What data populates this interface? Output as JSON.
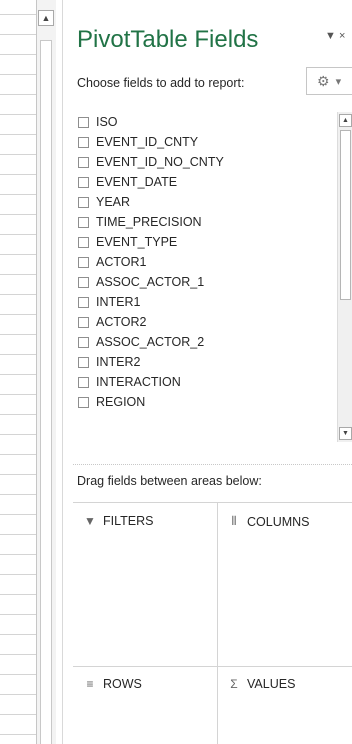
{
  "pane": {
    "title": "PivotTable Fields",
    "menu_glyph": "▼ ×",
    "choose_label": "Choose fields to add to report:",
    "tools_icon": "⚙",
    "tools_caret": "▾"
  },
  "fields": [
    {
      "label": "ISO",
      "checked": false
    },
    {
      "label": "EVENT_ID_CNTY",
      "checked": false
    },
    {
      "label": "EVENT_ID_NO_CNTY",
      "checked": false
    },
    {
      "label": "EVENT_DATE",
      "checked": false
    },
    {
      "label": "YEAR",
      "checked": false
    },
    {
      "label": "TIME_PRECISION",
      "checked": false
    },
    {
      "label": "EVENT_TYPE",
      "checked": false
    },
    {
      "label": "ACTOR1",
      "checked": false
    },
    {
      "label": "ASSOC_ACTOR_1",
      "checked": false
    },
    {
      "label": "INTER1",
      "checked": false
    },
    {
      "label": "ACTOR2",
      "checked": false
    },
    {
      "label": "ASSOC_ACTOR_2",
      "checked": false
    },
    {
      "label": "INTER2",
      "checked": false
    },
    {
      "label": "INTERACTION",
      "checked": false
    },
    {
      "label": "REGION",
      "checked": false
    }
  ],
  "drag_label": "Drag fields between areas below:",
  "areas": {
    "filters": {
      "label": "FILTERS",
      "icon": "▼"
    },
    "columns": {
      "label": "COLUMNS",
      "icon": "⦀"
    },
    "rows": {
      "label": "ROWS",
      "icon": "≡"
    },
    "values": {
      "label": "VALUES",
      "icon": "Σ"
    }
  },
  "scroll": {
    "up": "▲",
    "down": "▼"
  },
  "colors": {
    "accent": "#217346"
  }
}
